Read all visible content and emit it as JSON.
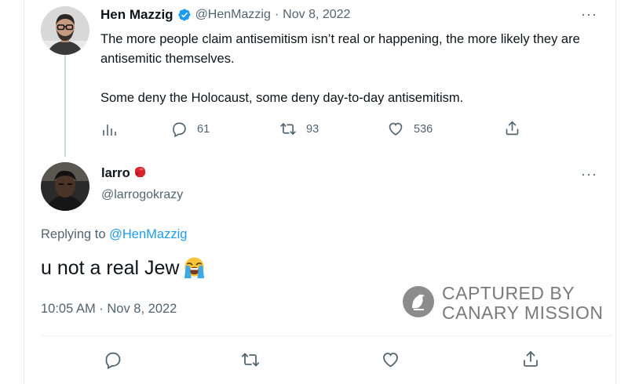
{
  "original_tweet": {
    "display_name": "Hen Mazzig",
    "handle": "@HenMazzig",
    "separator": "·",
    "date": "Nov 8, 2022",
    "verified_icon": "verified-badge-icon",
    "text_para1": "The more people claim antisemitism isn’t real or happening, the more likely they are antisemitic themselves.",
    "text_para2": "Some deny the Holocaust, some deny day-to-day antisemitism.",
    "more": "···",
    "metrics": {
      "analytics_icon": "analytics-icon",
      "replies": "61",
      "retweets": "93",
      "likes": "536"
    }
  },
  "reply_tweet": {
    "display_name": "larro",
    "name_emoji": "boxing-glove-emoji",
    "handle": "@larrogokrazy",
    "more": "···",
    "replying_prefix": "Replying to ",
    "replying_to": "@HenMazzig",
    "text": "u not a real Jew",
    "text_emoji": "loudly-crying-face-emoji",
    "timestamp": "10:05 AM · Nov 8, 2022"
  },
  "watermark": {
    "line1": "CAPTURED BY",
    "line2": "CANARY MISSION",
    "icon": "canary-bird-logo"
  },
  "colors": {
    "link": "#1d9bf0",
    "muted": "#536471",
    "text": "#0f1419",
    "verified": "#1d9bf0",
    "watermark": "#7a7a7a"
  }
}
